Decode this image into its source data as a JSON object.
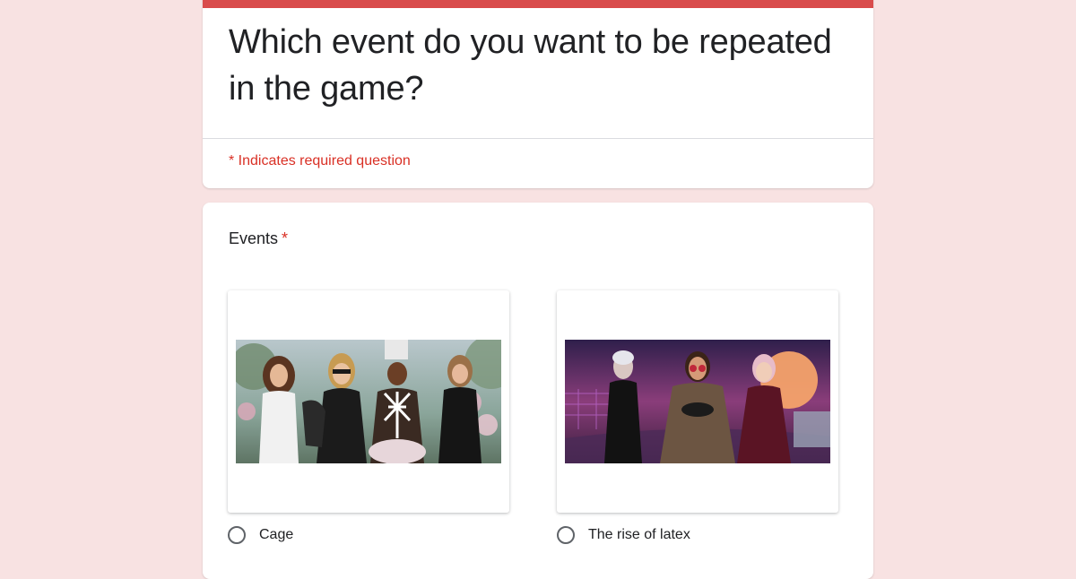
{
  "form": {
    "title": "Which event do you want to be repeated in the game?",
    "required_note": "* Indicates required question",
    "accent_color": "#d94b4b",
    "background_color": "#f8e2e2"
  },
  "question": {
    "title": "Events",
    "required_marker": "*",
    "options": [
      {
        "label": "Cage",
        "image": "event-cage-image"
      },
      {
        "label": "The rise of latex",
        "image": "event-latex-image"
      }
    ]
  }
}
